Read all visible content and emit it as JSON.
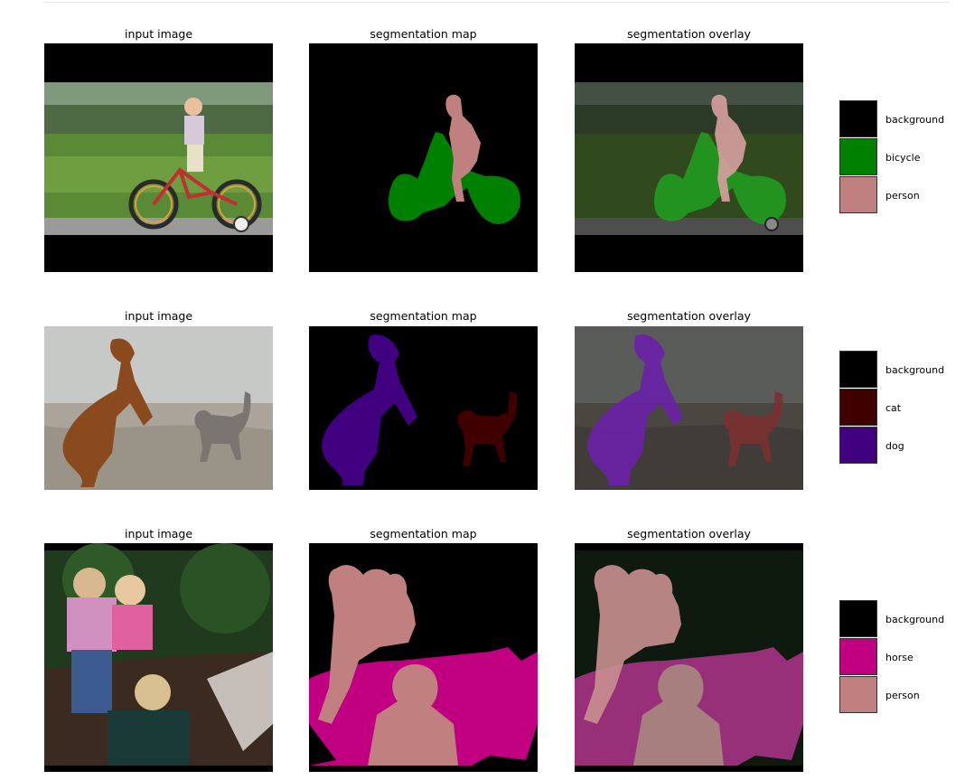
{
  "rows": [
    {
      "titles": {
        "input": "input image",
        "map": "segmentation map",
        "overlay": "segmentation overlay"
      },
      "legend": [
        {
          "label": "background",
          "color": "#000000"
        },
        {
          "label": "bicycle",
          "color": "#008000"
        },
        {
          "label": "person",
          "color": "#c08080"
        }
      ]
    },
    {
      "titles": {
        "input": "input image",
        "map": "segmentation map",
        "overlay": "segmentation overlay"
      },
      "legend": [
        {
          "label": "background",
          "color": "#000000"
        },
        {
          "label": "cat",
          "color": "#400000"
        },
        {
          "label": "dog",
          "color": "#400080"
        }
      ]
    },
    {
      "titles": {
        "input": "input image",
        "map": "segmentation map",
        "overlay": "segmentation overlay"
      },
      "legend": [
        {
          "label": "background",
          "color": "#000000"
        },
        {
          "label": "horse",
          "color": "#c00080"
        },
        {
          "label": "person",
          "color": "#c08080"
        }
      ]
    }
  ]
}
